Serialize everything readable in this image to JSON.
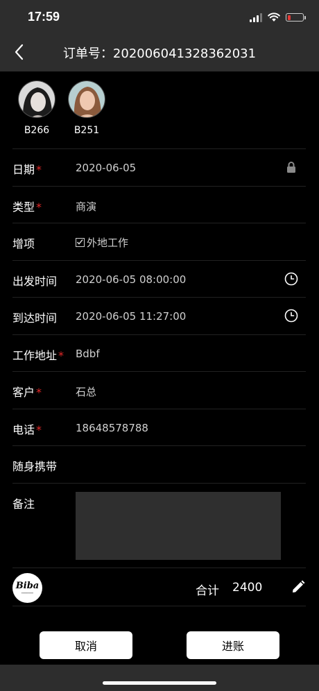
{
  "status_bar": {
    "time": "17:59"
  },
  "nav": {
    "title": "订单号：202006041328362031"
  },
  "models": [
    {
      "code": "B266"
    },
    {
      "code": "B251"
    }
  ],
  "form": {
    "date": {
      "label": "日期",
      "required_mark": "*",
      "value": "2020-06-05",
      "icon": "lock-icon"
    },
    "type": {
      "label": "类型",
      "required_mark": "*",
      "value": "商演"
    },
    "extras": {
      "label": "增项",
      "option_label": "外地工作",
      "checked": true
    },
    "departure": {
      "label": "出发时间",
      "value": "2020-06-05 08:00:00",
      "icon": "clock-icon"
    },
    "arrival": {
      "label": "到达时间",
      "value": "2020-06-05 11:27:00",
      "icon": "clock-icon"
    },
    "address": {
      "label": "工作地址",
      "required_mark": "*",
      "value": "Bdbf"
    },
    "client": {
      "label": "客户",
      "required_mark": "*",
      "value": "石总"
    },
    "phone": {
      "label": "电话",
      "required_mark": "*",
      "value": "18648578788"
    },
    "carry": {
      "label": "随身携带",
      "value": ""
    },
    "remark": {
      "label": "备注",
      "value": ""
    }
  },
  "footer": {
    "logo_text": "Biba",
    "total_label": "合计",
    "total_value": "2400",
    "cancel_label": "取消",
    "confirm_label": "进账"
  },
  "colors": {
    "background": "#000000",
    "bar": "#2d2d2d",
    "required": "#e52828",
    "remark_box": "#2f2f2f",
    "battery_low": "#e53935"
  }
}
